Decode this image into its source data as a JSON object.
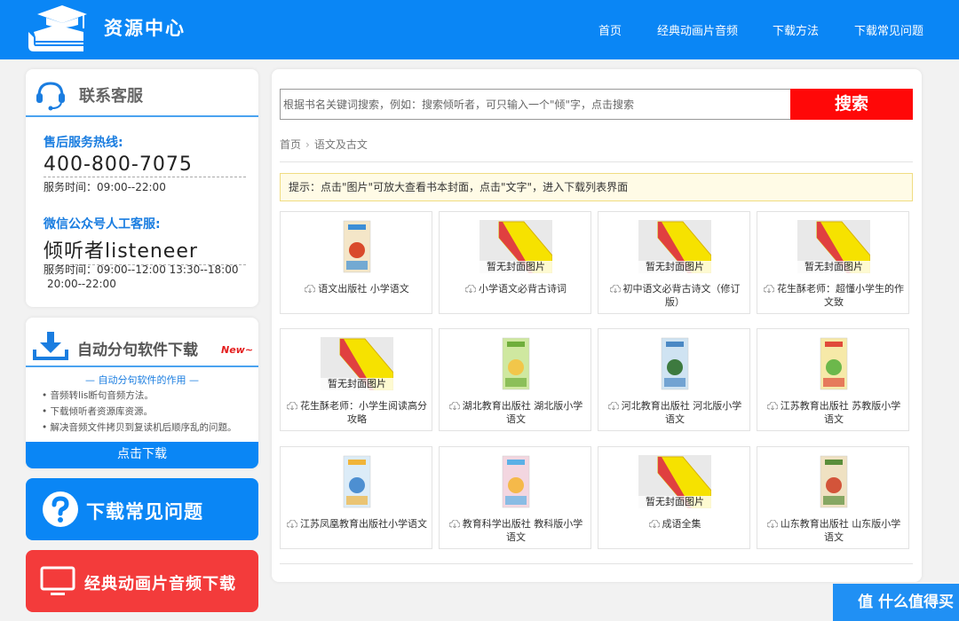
{
  "header": {
    "title": "资源中心",
    "nav": [
      "首页",
      "经典动画片音频",
      "下载方法",
      "下载常见问题"
    ]
  },
  "contact": {
    "title": "联系客服",
    "hotline_label": "售后服务热线:",
    "hotline_number": "400-800-7075",
    "hotline_hours": "服务时间：09:00--22:00",
    "wechat_label": "微信公众号人工客服:",
    "wechat_account": "倾听者listeneer",
    "wechat_hours_1": "服务时间：09:00--12:00 13:30--18:00",
    "wechat_hours_2": "20:00--22:00"
  },
  "software": {
    "title": "自动分句软件下载",
    "badge": "New~",
    "subtitle": "— 自动分句软件的作用 —",
    "bullets": [
      "• 音频转lis断句音频方法。",
      "• 下载倾听者资源库资源。",
      "• 解决音频文件拷贝到复读机后顺序乱的问题。"
    ],
    "button": "点击下载"
  },
  "faq_button": "下载常见问题",
  "anim_button": "经典动画片音频下载",
  "search": {
    "placeholder": "根据书名关键词搜索，例如：搜索倾听者，可只输入一个\"倾\"字，点击搜索",
    "button": "搜索"
  },
  "breadcrumb": [
    "首页",
    "语文及古文"
  ],
  "notice": "提示：点击\"图片\"可放大查看书本封面，点击\"文字\"，进入下载列表界面",
  "no_cover_label": "暂无封面图片",
  "books": [
    {
      "title": "语文出版社 小学语文",
      "cover": "image"
    },
    {
      "title": "小学语文必背古诗词",
      "cover": "none"
    },
    {
      "title": "初中语文必背古诗文（修订版）",
      "cover": "none"
    },
    {
      "title": "花生酥老师：超懂小学生的作文致",
      "cover": "none"
    },
    {
      "title": "花生酥老师：小学生阅读高分攻略",
      "cover": "none"
    },
    {
      "title": "湖北教育出版社 湖北版小学语文",
      "cover": "image"
    },
    {
      "title": "河北教育出版社 河北版小学语文",
      "cover": "image"
    },
    {
      "title": "江苏教育出版社 苏教版小学语文",
      "cover": "image"
    },
    {
      "title": "江苏凤凰教育出版社小学语文",
      "cover": "image"
    },
    {
      "title": "教育科学出版社 教科版小学语文",
      "cover": "image"
    },
    {
      "title": "成语全集",
      "cover": "none"
    },
    {
      "title": "山东教育出版社 山东版小学语文",
      "cover": "image"
    }
  ],
  "colors": {
    "primary": "#0a86f5",
    "danger": "#f33b3b",
    "search_button": "#ff0808",
    "notice_bg": "#fffbe6"
  }
}
